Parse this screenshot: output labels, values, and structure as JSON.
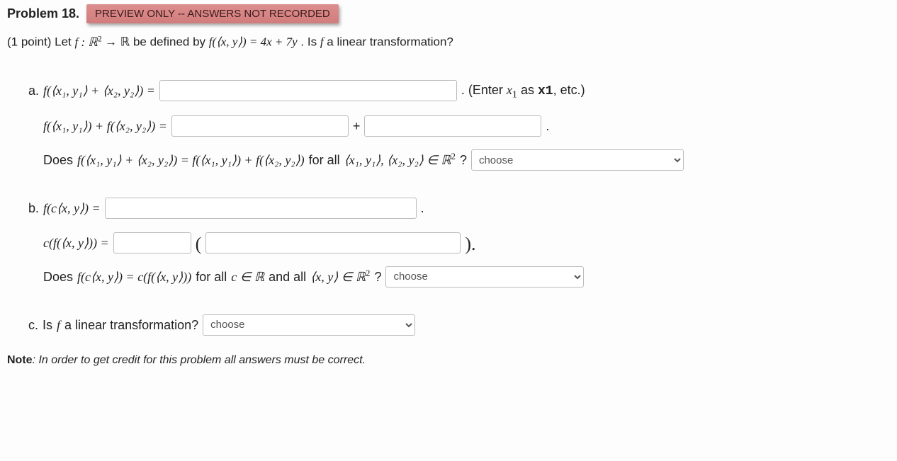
{
  "header": {
    "title": "Problem 18.",
    "badge": "PREVIEW ONLY -- ANSWERS NOT RECORDED"
  },
  "intro": {
    "points": "(1 point)",
    "let": "Let ",
    "fdef_pre": "f : ℝ",
    "fdef_exp": "2",
    "fdef_arrow": " → ℝ be defined by ",
    "feq": "f(⟨x, y⟩) = 4x + 7y",
    "question": ". Is ",
    "fsym": "f",
    "question2": " a linear transformation?"
  },
  "a": {
    "label": "a.",
    "lhs1": "f(⟨x₁, y₁⟩ + ⟨x₂, y₂⟩) = ",
    "hint_pre": ". (Enter ",
    "hint_x1m": "x",
    "hint_x1sub": "1",
    "hint_mid": " as ",
    "hint_x1tt": "x1",
    "hint_post": ", etc.)",
    "lhs2": "f(⟨x₁, y₁⟩) + f(⟨x₂, y₂⟩) = ",
    "plus": "+",
    "dot": ".",
    "q_pre": "Does ",
    "q_eq": "f(⟨x₁, y₁⟩ + ⟨x₂, y₂⟩) = f(⟨x₁, y₁⟩) + f(⟨x₂, y₂⟩)",
    "q_mid": " for all ",
    "q_set": "⟨x₁, y₁⟩, ⟨x₂, y₂⟩ ∈ ℝ",
    "q_exp": "2",
    "q_qm": "?",
    "select": "choose"
  },
  "b": {
    "label": "b.",
    "lhs1": "f(c⟨x, y⟩) = ",
    "dot1": ".",
    "lhs2": "c(f(⟨x, y⟩)) = ",
    "lp": "(",
    "rp": ").",
    "q_pre": "Does ",
    "q_eq": "f(c⟨x, y⟩) = c(f(⟨x, y⟩))",
    "q_mid": " for all ",
    "q_c": "c ∈ ℝ",
    "q_and": " and all ",
    "q_xy": "⟨x, y⟩ ∈ ℝ",
    "q_exp": "2",
    "q_qm": "?",
    "select": "choose"
  },
  "c": {
    "label": "c.",
    "q": " Is ",
    "fsym": "f",
    "q2": " a linear transformation? ",
    "select": "choose"
  },
  "note": {
    "bold": "Note",
    "text": ": In order to get credit for this problem all answers must be correct."
  }
}
